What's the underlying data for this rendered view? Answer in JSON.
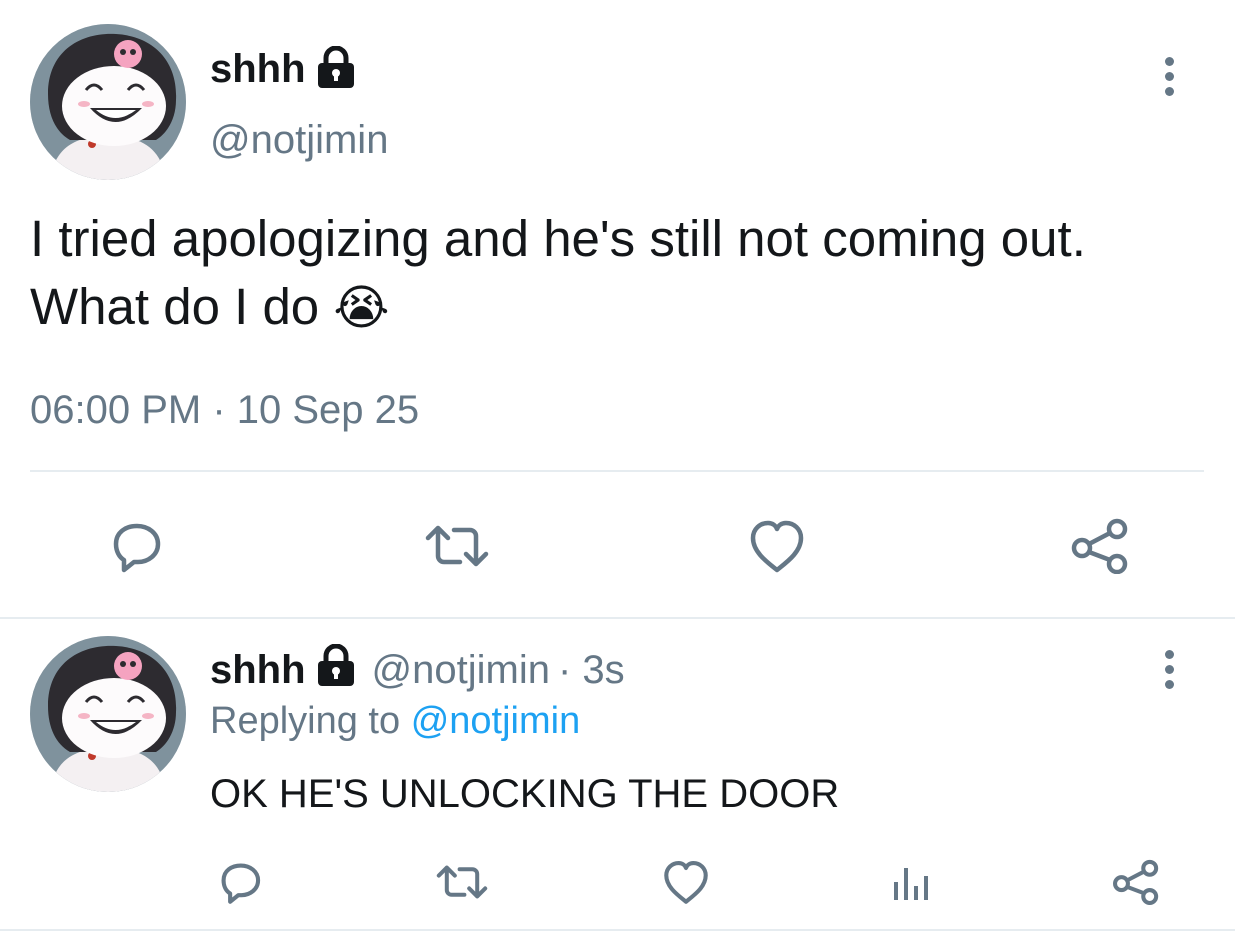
{
  "main_tweet": {
    "display_name": "shhh",
    "handle": "@notjimin",
    "text": "I tried apologizing and he's still not coming out. What do I do",
    "emoji": "😭",
    "timestamp": "06:00 PM · 10 Sep 25"
  },
  "reply_tweet": {
    "display_name": "shhh",
    "handle": "@notjimin",
    "age": "· 3s",
    "replying_prefix": "Replying to",
    "replying_handle": "@notjimin",
    "text": "OK HE'S UNLOCKING THE DOOR"
  },
  "icons": {
    "lock": "lock-icon",
    "more": "more-vertical-icon",
    "reply": "reply-icon",
    "retweet": "retweet-icon",
    "like": "heart-icon",
    "analytics": "analytics-icon",
    "share": "share-icon"
  },
  "colors": {
    "text": "#14171a",
    "secondary": "#657786",
    "link": "#1da1f2",
    "divider": "#e6ecf0"
  }
}
